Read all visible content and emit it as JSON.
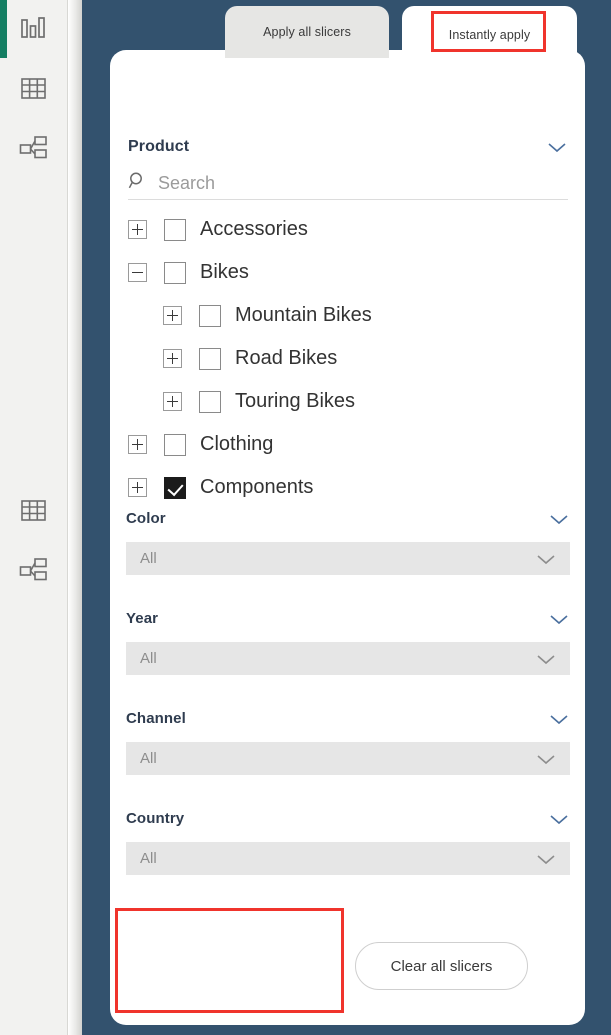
{
  "theme": {
    "navy": "#33526e",
    "rail_bg": "#f2f2f0",
    "accent_green": "#157f63",
    "annotation_red": "#f0342c",
    "dropdown_bg": "#e6e6e6",
    "card_bg": "#ffffff"
  },
  "left_rail": {
    "items": [
      {
        "name": "report-view-icon",
        "icon": "bar-chart-icon",
        "active": true
      },
      {
        "name": "data-view-icon",
        "icon": "table-grid-icon",
        "active": false
      },
      {
        "name": "model-view-icon",
        "icon": "relationship-diagram-icon",
        "active": false
      },
      {
        "name": "data-view-icon-2",
        "icon": "table-grid-icon",
        "active": false
      },
      {
        "name": "model-view-icon-2",
        "icon": "relationship-diagram-icon",
        "active": false
      }
    ]
  },
  "tabs": [
    {
      "label": "Apply all slicers",
      "active": false
    },
    {
      "label": "Instantly apply",
      "active": true
    }
  ],
  "slicer_panel": {
    "product": {
      "title": "Product",
      "collapse_icon": "chevron-down-icon",
      "search": {
        "icon": "search-icon",
        "placeholder": "Search",
        "value": ""
      },
      "tree": [
        {
          "label": "Accessories",
          "level": 1,
          "expander": "plus",
          "checked": false
        },
        {
          "label": "Bikes",
          "level": 1,
          "expander": "minus",
          "checked": false
        },
        {
          "label": "Mountain Bikes",
          "level": 2,
          "expander": "plus",
          "checked": false
        },
        {
          "label": "Road Bikes",
          "level": 2,
          "expander": "plus",
          "checked": false
        },
        {
          "label": "Touring Bikes",
          "level": 2,
          "expander": "plus",
          "checked": false
        },
        {
          "label": "Clothing",
          "level": 1,
          "expander": "plus",
          "checked": false
        },
        {
          "label": "Components",
          "level": 1,
          "expander": "plus",
          "checked": true
        }
      ]
    },
    "filters": [
      {
        "title": "Color",
        "value": "All",
        "collapse_icon": "chevron-down-icon",
        "dropdown_icon": "chevron-down-icon"
      },
      {
        "title": "Year",
        "value": "All",
        "collapse_icon": "chevron-down-icon",
        "dropdown_icon": "chevron-down-icon"
      },
      {
        "title": "Channel",
        "value": "All",
        "collapse_icon": "chevron-down-icon",
        "dropdown_icon": "chevron-down-icon"
      },
      {
        "title": "Country",
        "value": "All",
        "collapse_icon": "chevron-down-icon",
        "dropdown_icon": "chevron-down-icon"
      }
    ],
    "footer": {
      "clear_button_label": "Clear all slicers"
    }
  },
  "annotations": [
    {
      "name": "instantly-apply-highlight",
      "target": "Instantly apply"
    },
    {
      "name": "apply-button-area-highlight",
      "target": ""
    }
  ]
}
